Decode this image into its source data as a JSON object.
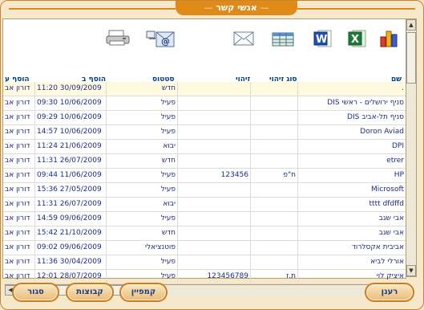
{
  "window": {
    "title": "אנשי קשר",
    "title_decoration_left": "—",
    "title_decoration_right": "—"
  },
  "toolbar": {
    "icons": [
      "print-icon",
      "email-send-icon",
      "envelope-icon",
      "table-grid-icon",
      "word-icon",
      "excel-icon",
      "bar-chart-icon"
    ]
  },
  "columns": {
    "name": "שם",
    "id_type": "סוג זיהוי",
    "id": "זיהוי",
    "status": "סטטוס",
    "added_date": "הוסף ב",
    "added_by": "הוסף ע"
  },
  "rows": [
    {
      "name": ".",
      "id_type": "",
      "id": "",
      "status": "חדש",
      "added_date": "11:20 30/09/2009",
      "added_by": "דורון אב"
    },
    {
      "name": "DIS סניף ירושלים - ראשי",
      "id_type": "",
      "id": "",
      "status": "פעיל",
      "added_date": "09:30 10/06/2009",
      "added_by": "דורון אב"
    },
    {
      "name": "DIS סניף תל-אביב",
      "id_type": "",
      "id": "",
      "status": "פעיל",
      "added_date": "09:29 10/06/2009",
      "added_by": "דורון אב"
    },
    {
      "name": "Doron Aviad",
      "id_type": "",
      "id": "",
      "status": "פעיל",
      "added_date": "14:57 10/06/2009",
      "added_by": "דורון אב"
    },
    {
      "name": "DPI",
      "id_type": "",
      "id": "",
      "status": "יבוא",
      "added_date": "11:24 21/06/2009",
      "added_by": "דורון אב"
    },
    {
      "name": "etrer",
      "id_type": "",
      "id": "",
      "status": "חדש",
      "added_date": "11:31 26/07/2009",
      "added_by": "דורון אב"
    },
    {
      "name": "HP",
      "id_type": "ח\"פ",
      "id": "123456",
      "status": "פעיל",
      "added_date": "09:44 11/06/2009",
      "added_by": "דורון אב"
    },
    {
      "name": "Microsoft",
      "id_type": "",
      "id": "",
      "status": "פעיל",
      "added_date": "15:36 27/05/2009",
      "added_by": "דורון אב"
    },
    {
      "name": "tttt dfdffd",
      "id_type": "",
      "id": "",
      "status": "יבוא",
      "added_date": "11:31 26/07/2009",
      "added_by": "דורון אב"
    },
    {
      "name": "אבי שגב",
      "id_type": "",
      "id": "",
      "status": "פעיל",
      "added_date": "14:59 09/06/2009",
      "added_by": "דורון אב"
    },
    {
      "name": "אבי שגב",
      "id_type": "",
      "id": "",
      "status": "חדש",
      "added_date": "15:42 21/10/2009",
      "added_by": "דורון אב"
    },
    {
      "name": "אביבית אקסלרוד",
      "id_type": "",
      "id": "",
      "status": "פוטנציאלי",
      "added_date": "09:02 09/06/2009",
      "added_by": "דורון אב"
    },
    {
      "name": "אורלי לביא",
      "id_type": "",
      "id": "",
      "status": "פעיל",
      "added_date": "11:36 30/04/2009",
      "added_by": "דורון אב"
    },
    {
      "name": "איציק לוי",
      "id_type": "ת.ז",
      "id": "123456789",
      "status": "פעיל",
      "added_date": "12:01 28/07/2009",
      "added_by": "דורון אב"
    }
  ],
  "buttons": {
    "refresh": "רענן",
    "campaign": "קמפיין",
    "groups": "קבוצות",
    "close": "סגור"
  }
}
